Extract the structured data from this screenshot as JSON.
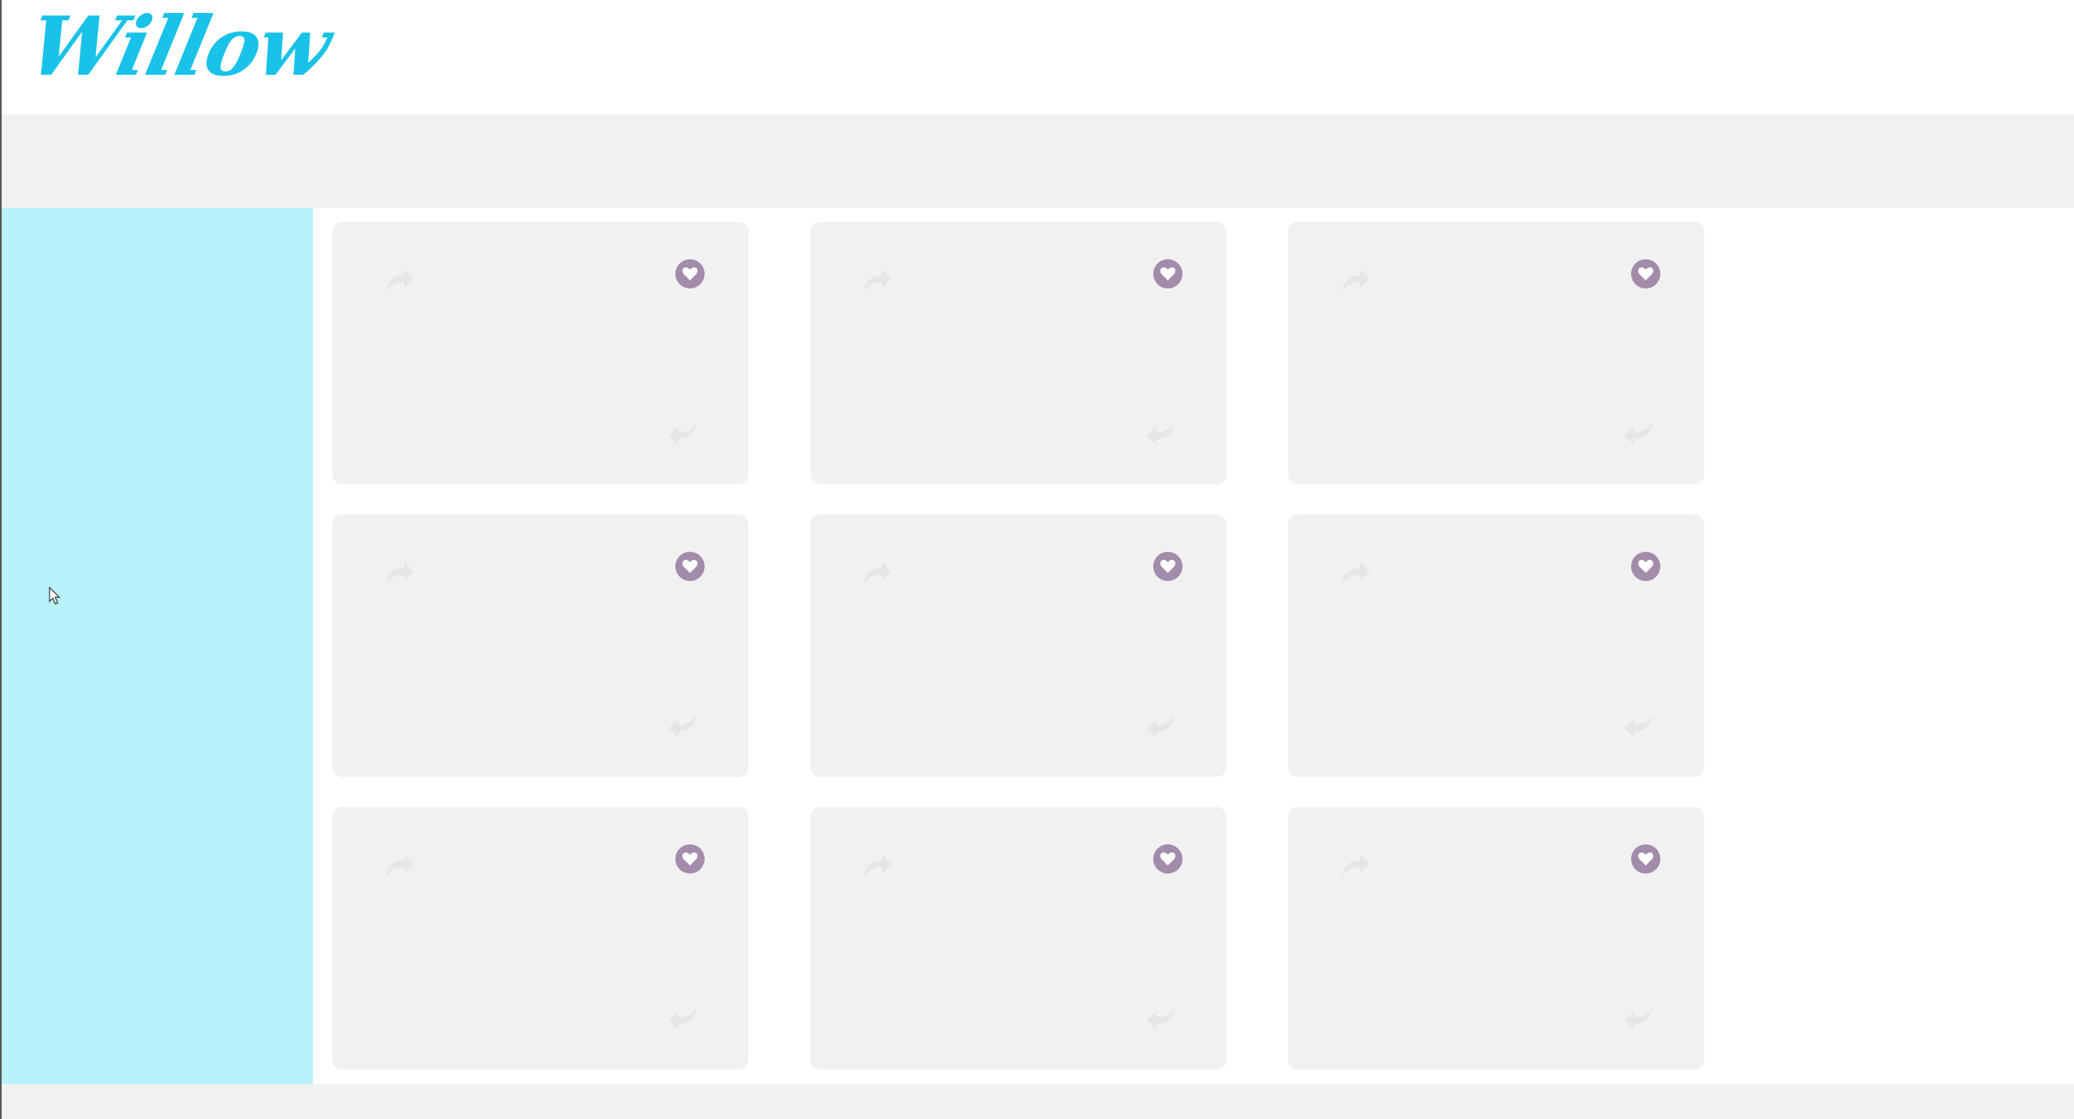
{
  "header": {
    "logo_text": "Willow",
    "logo_color": "#18c2e8"
  },
  "colors": {
    "sidebar": "#b8f2fc",
    "card": "#f1f1f1",
    "favorite_button": "#a28bab"
  },
  "cards": [
    {
      "icons": [
        "share-icon",
        "heart-icon",
        "reply-icon"
      ]
    },
    {
      "icons": [
        "share-icon",
        "heart-icon",
        "reply-icon"
      ]
    },
    {
      "icons": [
        "share-icon",
        "heart-icon",
        "reply-icon"
      ]
    },
    {
      "icons": [
        "share-icon",
        "heart-icon",
        "reply-icon"
      ]
    },
    {
      "icons": [
        "share-icon",
        "heart-icon",
        "reply-icon"
      ]
    },
    {
      "icons": [
        "share-icon",
        "heart-icon",
        "reply-icon"
      ]
    },
    {
      "icons": [
        "share-icon",
        "heart-icon",
        "reply-icon"
      ]
    },
    {
      "icons": [
        "share-icon",
        "heart-icon",
        "reply-icon"
      ]
    },
    {
      "icons": [
        "share-icon",
        "heart-icon",
        "reply-icon"
      ]
    }
  ]
}
